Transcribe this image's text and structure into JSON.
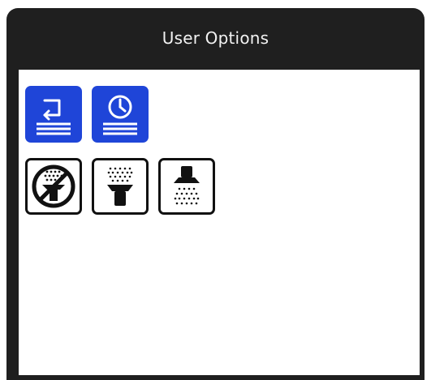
{
  "window": {
    "title": "User Options"
  },
  "colors": {
    "titlebar_bg": "#1f1f1f",
    "accent_blue": "#1f45d8",
    "content_bg": "#ffffff"
  },
  "icons": {
    "row1": [
      "return-menu-icon",
      "timer-menu-icon"
    ],
    "row2": [
      "no-spray-icon",
      "spray-up-icon",
      "spray-down-icon"
    ]
  }
}
